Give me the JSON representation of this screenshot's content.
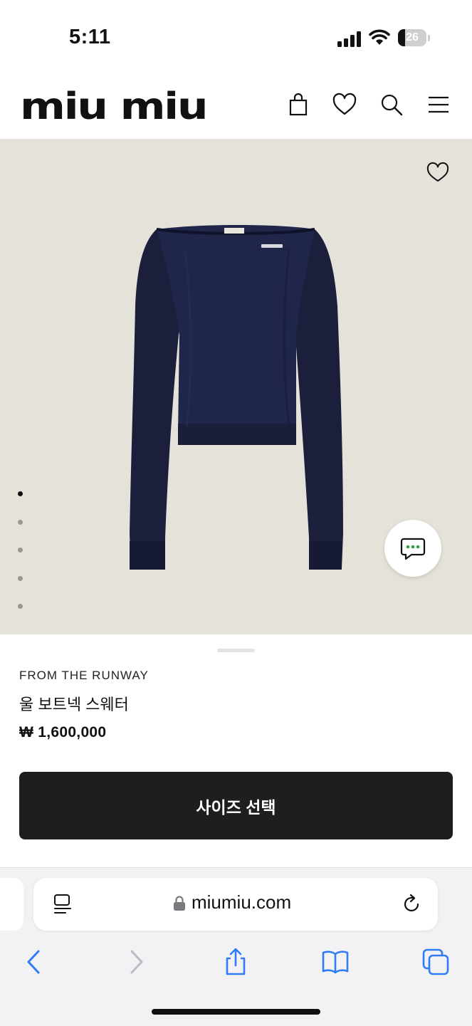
{
  "status_bar": {
    "time": "5:11",
    "battery_level": "26",
    "icons": [
      "cellular-signal-icon",
      "wifi-icon",
      "battery-icon"
    ]
  },
  "header": {
    "logo_text": "miu miu",
    "icons": [
      "shopping-bag-icon",
      "heart-icon",
      "search-icon",
      "menu-icon"
    ]
  },
  "product": {
    "image_alt_icon": "sweater-image",
    "gallery_count": 5,
    "gallery_active_index": 0,
    "eyebrow": "FROM THE RUNWAY",
    "name": "울 보트넥 스웨터",
    "price": "₩ 1,600,000",
    "cta_label": "사이즈 선택"
  },
  "browser": {
    "url": "miumiu.com",
    "toolbar_icons": [
      "back-icon",
      "forward-icon",
      "share-icon",
      "bookmarks-icon",
      "tabs-icon"
    ]
  },
  "colors": {
    "hero_background": "#e5e2da",
    "sweater_navy": "#1d2140",
    "cta_background": "#1e1e1e",
    "browser_accent": "#2f7cf6",
    "chat_dots_green": "#2e9b45"
  }
}
